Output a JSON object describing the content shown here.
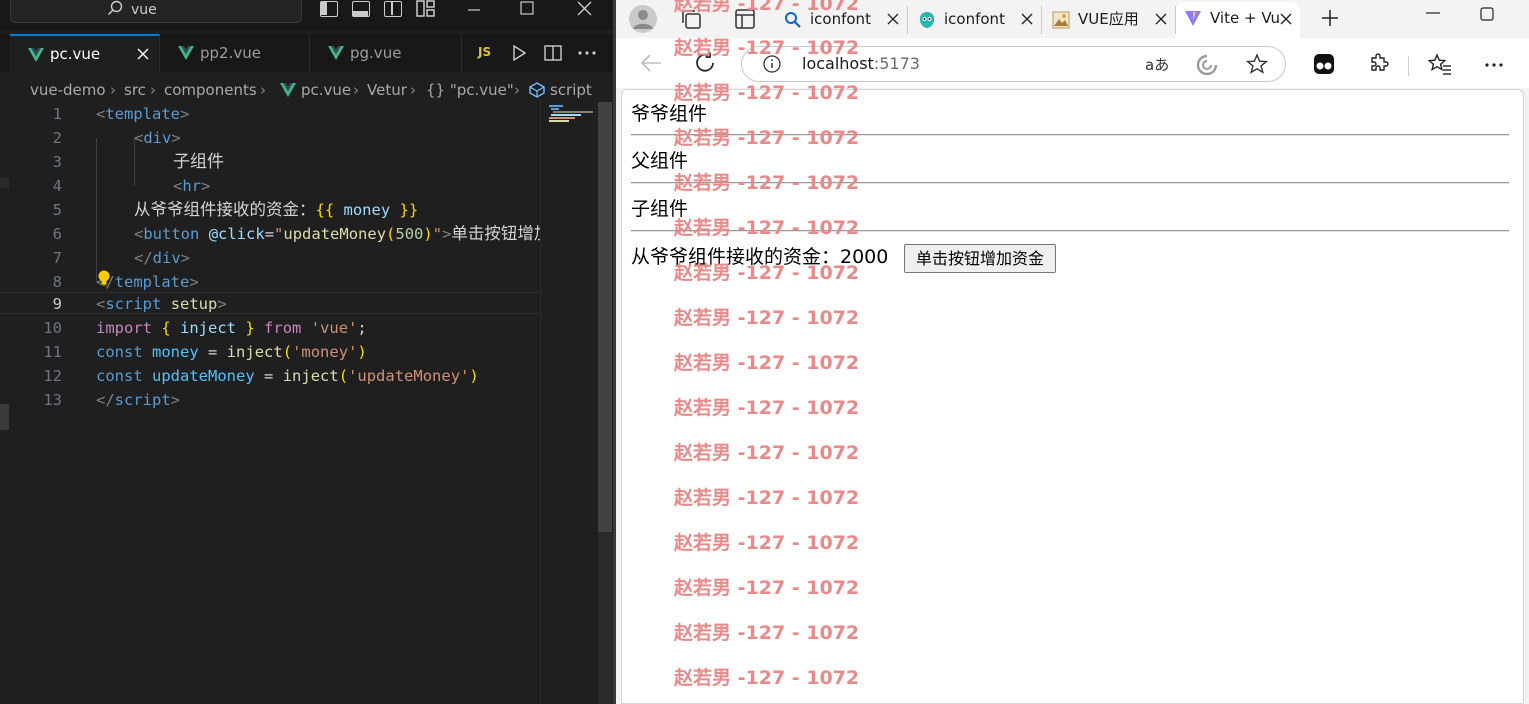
{
  "vscode": {
    "search_text": "vue",
    "tabs": [
      {
        "label": "pc.vue",
        "active": true
      },
      {
        "label": "pp2.vue",
        "active": false
      },
      {
        "label": "pg.vue",
        "active": false
      }
    ],
    "tab_js_badge": "JS",
    "breadcrumb": [
      "vue-demo",
      "src",
      "components",
      "pc.vue",
      "Vetur",
      "{} \"pc.vue\"",
      "script"
    ],
    "line_numbers": [
      "1",
      "2",
      "3",
      "4",
      "5",
      "6",
      "7",
      "8",
      "9",
      "10",
      "11",
      "12",
      "13"
    ],
    "current_line": "9",
    "code": {
      "l1_tag": "template",
      "l2_tag": "div",
      "l3_text": "子组件",
      "l4_tag": "hr",
      "l5_text": "从爷爷组件接收的资金：",
      "l5_var": "money",
      "l6_tag": "button",
      "l6_attr": "@click",
      "l6_fn": "updateMoney",
      "l6_num": "500",
      "l6_text": "单击按钮增加资金",
      "l7_tag": "div",
      "l8_tag": "template",
      "l9_tag": "script",
      "l9_attr": "setup",
      "l10_kw": "import",
      "l10_name": "inject",
      "l10_from": "from",
      "l10_str": "'vue'",
      "l11_kw": "const",
      "l11_name": "money",
      "l11_fn": "inject",
      "l11_str": "'money'",
      "l12_kw": "const",
      "l12_name": "updateMoney",
      "l12_fn": "inject",
      "l12_str": "'updateMoney'",
      "l13_tag": "script"
    },
    "colors": {
      "accent": "#0078d4",
      "background": "#1f1f1f"
    }
  },
  "browser": {
    "tabs": [
      {
        "label": "iconfont",
        "favicon": "search-icon"
      },
      {
        "label": "iconfont",
        "favicon": "iconfont-logo"
      },
      {
        "label": "VUE应用",
        "favicon": "image-favicon"
      },
      {
        "label": "Vite + Vu",
        "favicon": "vite-logo",
        "active": true
      }
    ],
    "url_host": "localhost",
    "url_port": ":5173",
    "read_aloud_label": "aあ",
    "page": {
      "grandparent_label": "爷爷组件",
      "parent_label": "父组件",
      "child_label": "子组件",
      "money_text": "从爷爷组件接收的资金：2000",
      "add_money_button": "单击按钮增加资金"
    },
    "watermark": "赵若男 -127 - 1072"
  }
}
